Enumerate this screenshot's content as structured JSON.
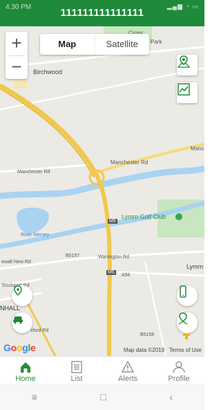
{
  "status": {
    "time": "4:30 PM",
    "icons": "▂▄▆ ◔ ▭"
  },
  "header": {
    "title": "111111111111111"
  },
  "map": {
    "zoom_in": "+",
    "zoom_out": "−",
    "type_map": "Map",
    "type_satellite": "Satellite",
    "labels": {
      "birchwood": "Birchwood",
      "manchester_rd_left": "Manchester Rd",
      "manchester_rd_right": "Manchester Rd",
      "manchester_rd_far": "Manche",
      "lymm_golf": "Lymm Golf Club",
      "river_mersey": "River Mersey",
      "m6_top": "M6",
      "m6_bottom": "M6",
      "warrington_rd": "Warrington Rd",
      "b5157": "B5157",
      "a56": "A56",
      "newall_rd": "ewall New Rd",
      "stockport_rd": "Stockport Rd",
      "nhall": "NHALL",
      "lymm": "Lymm",
      "rd_bottom": "sford Rd",
      "b5158": "B5158",
      "top_park": "Park",
      "top_cross": "Cross"
    },
    "google": "Google",
    "map_data": "Map data ©2019",
    "terms": "Terms of Use"
  },
  "tabs": [
    {
      "label": "Home"
    },
    {
      "label": "List"
    },
    {
      "label": "Alerts"
    },
    {
      "label": "Profile"
    }
  ],
  "nav": {
    "menu": "≡",
    "home": "□",
    "back": "‹"
  },
  "colors": {
    "brand": "#1e8a3a",
    "motorway": "#f2c84b",
    "water": "#a9d3f1",
    "park": "#c8e6c0"
  }
}
